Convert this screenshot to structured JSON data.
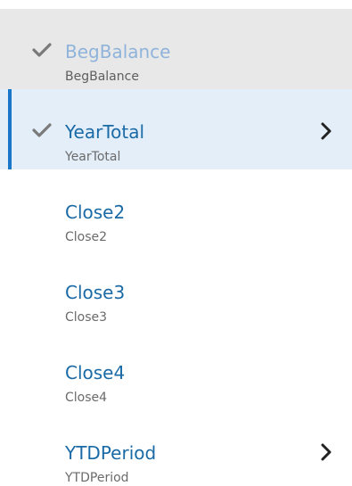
{
  "items": [
    {
      "label": "BegBalance",
      "sublabel": "BegBalance",
      "checked": true,
      "has_children": false
    },
    {
      "label": "YearTotal",
      "sublabel": "YearTotal",
      "checked": true,
      "has_children": true,
      "selected": true
    },
    {
      "label": "Close2",
      "sublabel": "Close2",
      "checked": false,
      "has_children": false
    },
    {
      "label": "Close3",
      "sublabel": "Close3",
      "checked": false,
      "has_children": false
    },
    {
      "label": "Close4",
      "sublabel": "Close4",
      "checked": false,
      "has_children": false
    },
    {
      "label": "YTDPeriod",
      "sublabel": "YTDPeriod",
      "checked": false,
      "has_children": true
    }
  ],
  "colors": {
    "accent": "#1976c8",
    "label": "#1a6aa6",
    "disabled_label": "#8fb3da",
    "selected_bg": "#e3eef9",
    "disabled_bg": "#e8e8e8"
  }
}
